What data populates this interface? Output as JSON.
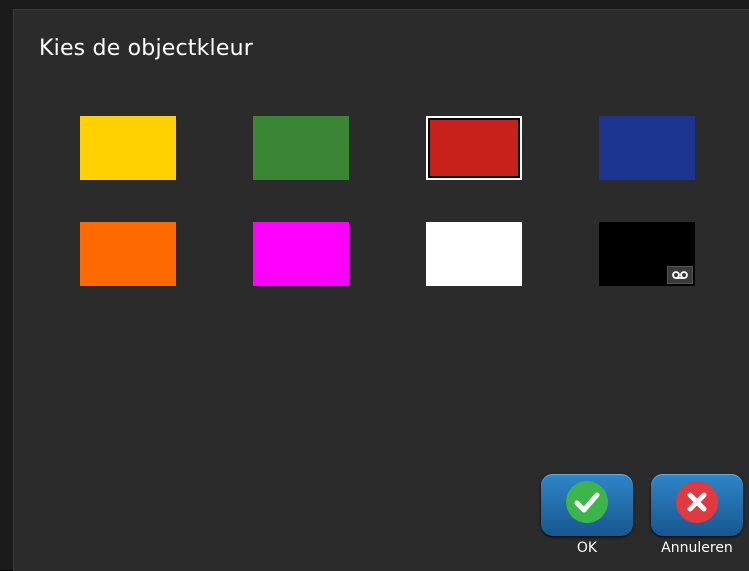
{
  "dialog": {
    "title": "Kies de objectkleur"
  },
  "colors": [
    {
      "name": "yellow",
      "hex": "#FFD100"
    },
    {
      "name": "green",
      "hex": "#3A8634"
    },
    {
      "name": "red",
      "hex": "#C8211B",
      "selected": true
    },
    {
      "name": "blue",
      "hex": "#1B3591"
    },
    {
      "name": "orange",
      "hex": "#FF6A00"
    },
    {
      "name": "magenta",
      "hex": "#FF00FF"
    },
    {
      "name": "white",
      "hex": "#FFFFFF"
    },
    {
      "name": "black",
      "hex": "#000000",
      "icon": "tape-icon"
    }
  ],
  "buttons": {
    "ok_label": "OK",
    "cancel_label": "Annuleren",
    "ok_icon": "checkmark-icon",
    "cancel_icon": "close-icon",
    "ok_color": "#3DB54A",
    "cancel_color": "#E2393F"
  }
}
